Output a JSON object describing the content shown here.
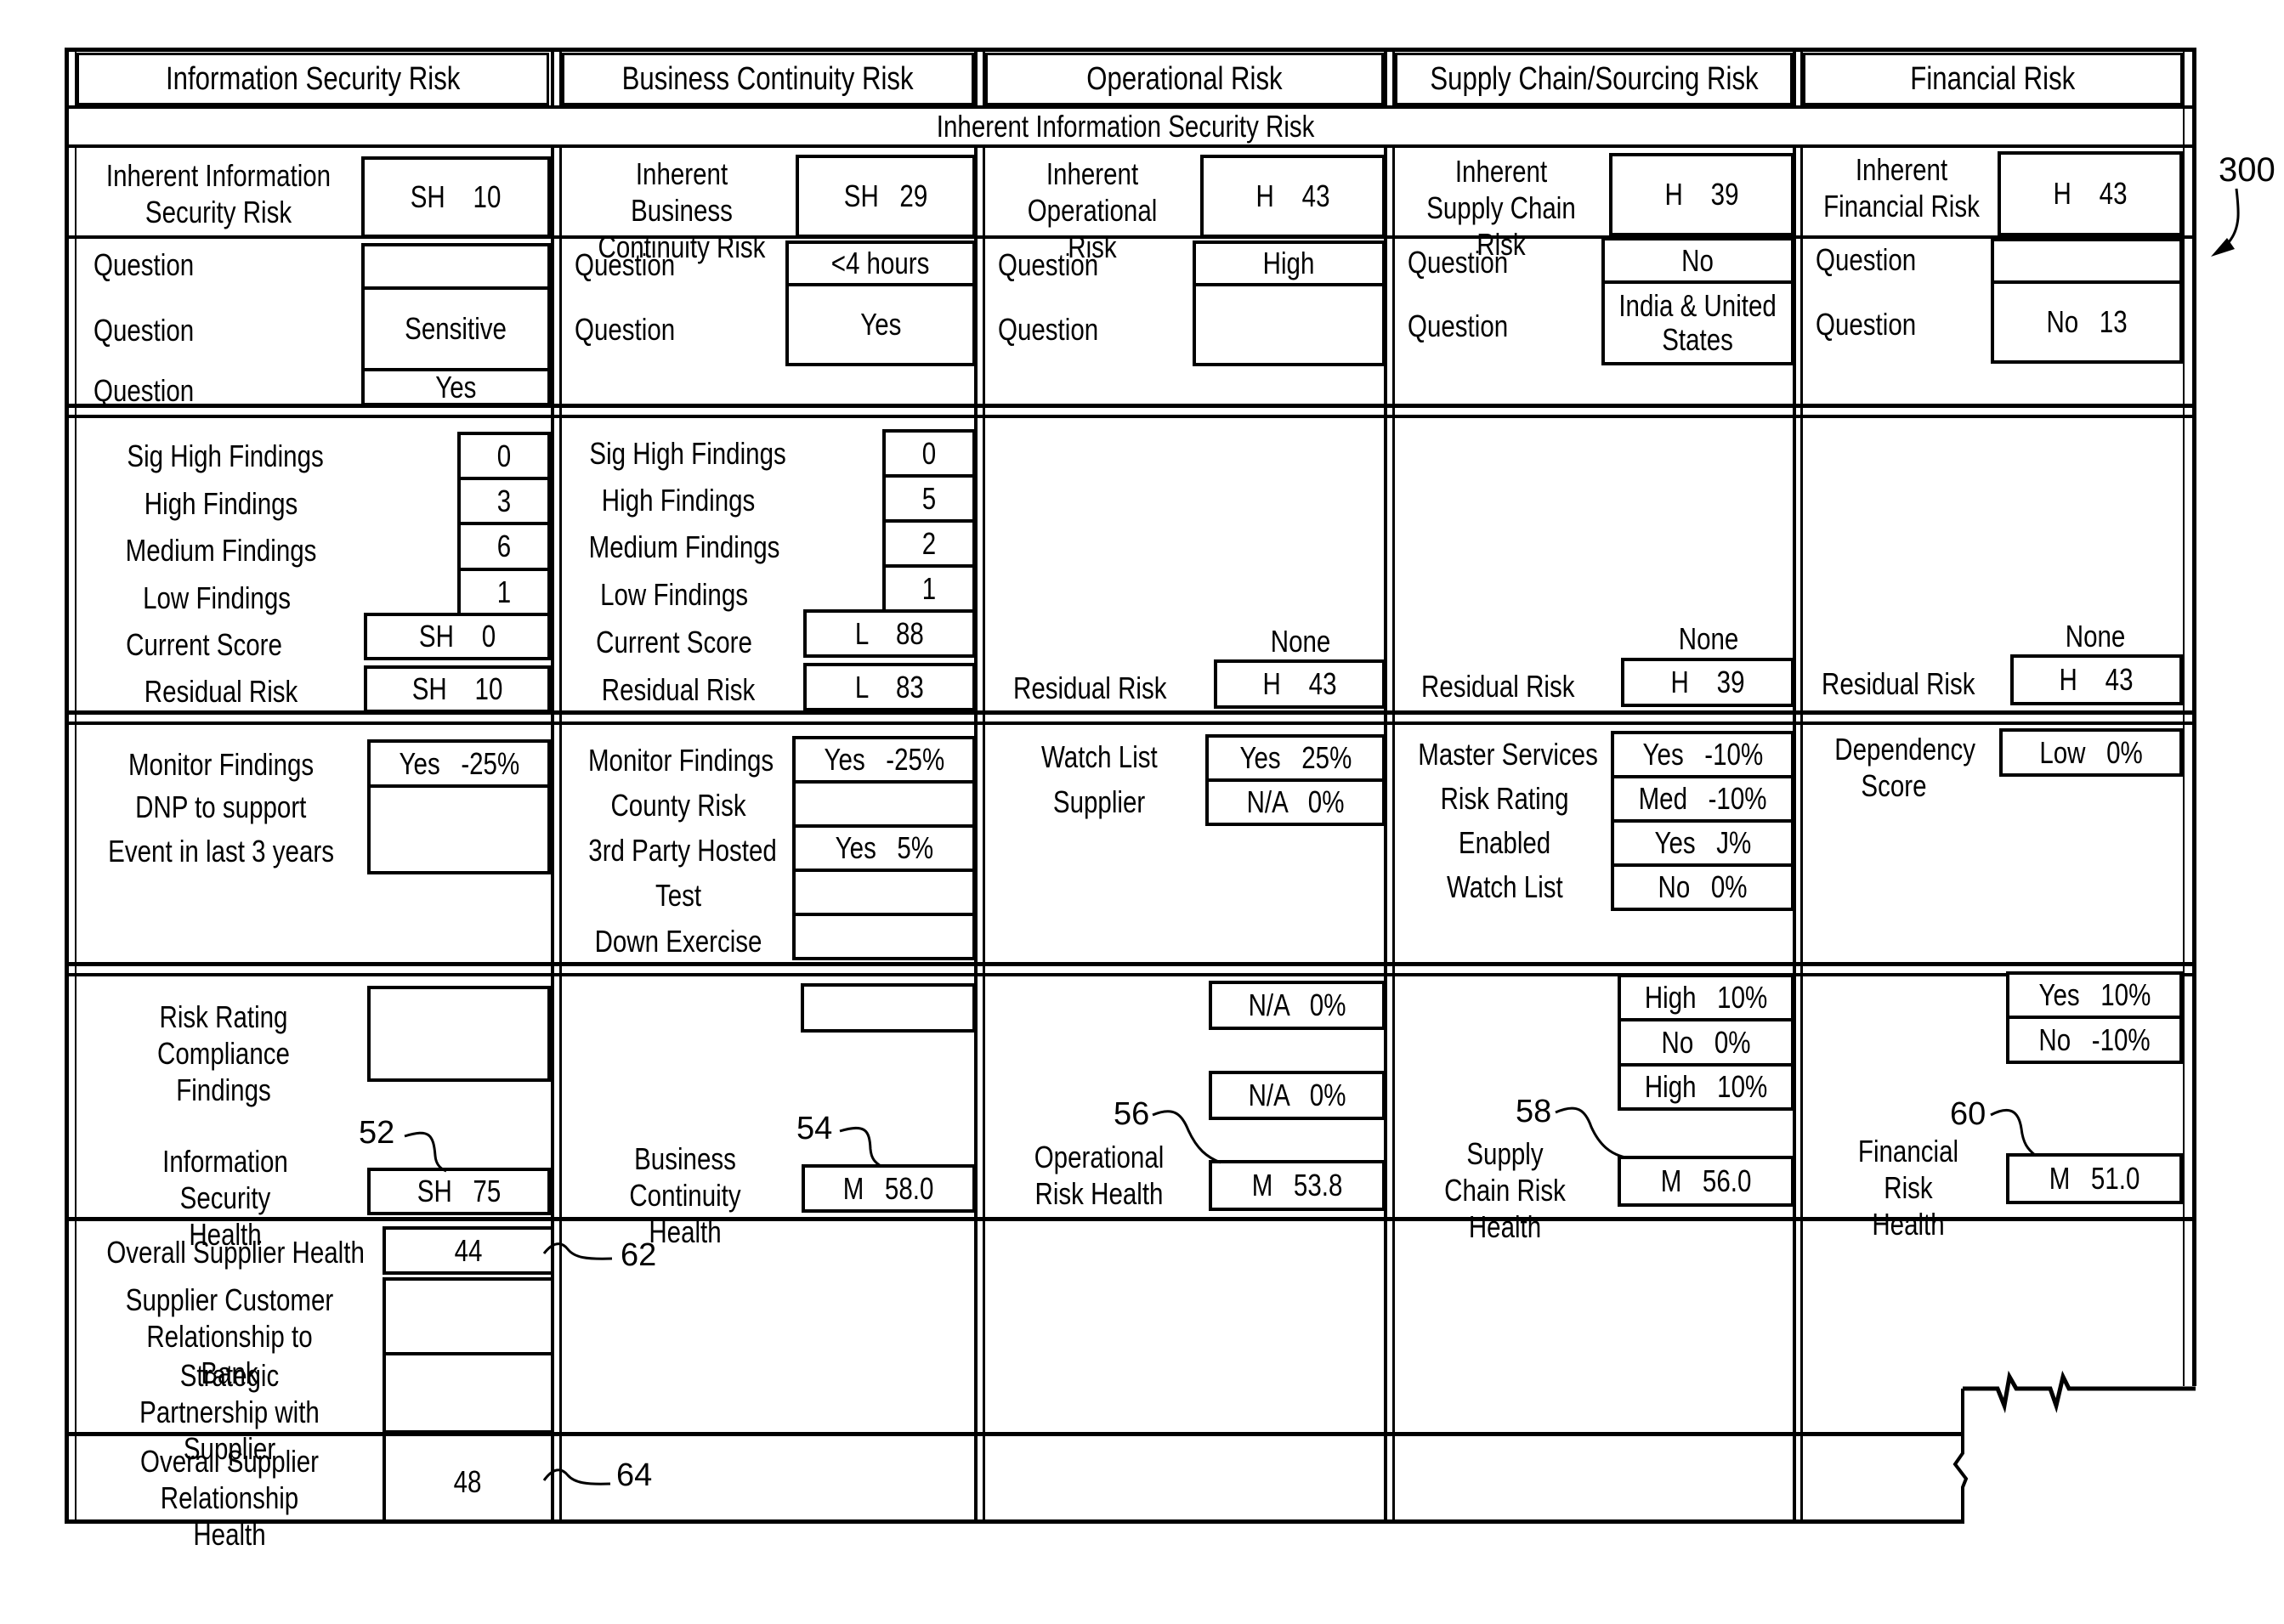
{
  "figure_label": "300",
  "columns": [
    {
      "header": "Information Security Risk"
    },
    {
      "header": "Business Continuity Risk"
    },
    {
      "header": "Operational Risk"
    },
    {
      "header": "Supply Chain/Sourcing Risk"
    },
    {
      "header": "Financial Risk"
    }
  ],
  "subheader": "Inherent Information Security Risk",
  "inherent": [
    {
      "label": "Inherent Information Security Risk",
      "value": "SH    10"
    },
    {
      "label": "Inherent Business Continuity Risk",
      "value": "SH   29"
    },
    {
      "label": "Inherent Operational Risk",
      "value": "H    43"
    },
    {
      "label": "Inherent Supply Chain Risk",
      "value": "H    39"
    },
    {
      "label": "Inherent Financial Risk",
      "value": "H    43"
    }
  ],
  "questions": {
    "info_security": [
      {
        "label": "Question",
        "value": ""
      },
      {
        "label": "Question",
        "value": "Sensitive"
      },
      {
        "label": "Question",
        "value": "Yes"
      }
    ],
    "business_continuity": [
      {
        "label": "Question",
        "value": "<4 hours"
      },
      {
        "label": "Question",
        "value": "Yes"
      }
    ],
    "operational": [
      {
        "label": "Question",
        "value": "High"
      },
      {
        "label": "Question",
        "value": ""
      }
    ],
    "supply_chain": [
      {
        "label": "Question",
        "value": "No"
      },
      {
        "label": "Question",
        "value": "India & United\nStates"
      }
    ],
    "financial": [
      {
        "label": "Question",
        "value": ""
      },
      {
        "label": "Question",
        "value": "No   13"
      }
    ]
  },
  "findings": {
    "info_security": {
      "sig_high": {
        "label": "Sig High Findings",
        "value": "0"
      },
      "high": {
        "label": "High Findings",
        "value": "3"
      },
      "medium": {
        "label": "Medium Findings",
        "value": "6"
      },
      "low": {
        "label": "Low Findings",
        "value": "1"
      },
      "current_score": {
        "label": "Current Score",
        "value": "SH    0"
      },
      "residual_risk": {
        "label": "Residual Risk",
        "value": "SH    10"
      }
    },
    "business_continuity": {
      "sig_high": {
        "label": "Sig High Findings",
        "value": "0"
      },
      "high": {
        "label": "High Findings",
        "value": "5"
      },
      "medium": {
        "label": "Medium Findings",
        "value": "2"
      },
      "low": {
        "label": "Low Findings",
        "value": "1"
      },
      "current_score": {
        "label": "Current Score",
        "value": "L    88"
      },
      "residual_risk": {
        "label": "Residual Risk",
        "value": "L    83"
      }
    },
    "operational": {
      "none_label": "None",
      "residual_label": "Residual Risk",
      "residual_value": "H    43"
    },
    "supply_chain": {
      "none_label": "None",
      "residual_label": "Residual Risk",
      "residual_value": "H    39"
    },
    "financial": {
      "none_label": "None",
      "residual_label": "Residual Risk",
      "residual_value": "H    43"
    }
  },
  "adjustments": {
    "info_security": [
      {
        "label": "Monitor Findings",
        "value": "Yes   -25%"
      },
      {
        "label": "DNP to support",
        "value": ""
      },
      {
        "label": "Event in last 3 years",
        "value": ""
      }
    ],
    "business_continuity": [
      {
        "label": "Monitor Findings",
        "value": "Yes   -25%"
      },
      {
        "label": "County Risk",
        "value": ""
      },
      {
        "label": "3rd Party Hosted",
        "value": "Yes   5%"
      },
      {
        "label": "Test",
        "value": ""
      },
      {
        "label": "Down Exercise",
        "value": ""
      }
    ],
    "operational": [
      {
        "label": "Watch List",
        "value": "Yes   25%"
      },
      {
        "label": "Supplier",
        "value": "N/A   0%"
      }
    ],
    "supply_chain": [
      {
        "label": "Master Services",
        "value": "Yes   -10%"
      },
      {
        "label": "Risk Rating",
        "value": "Med   -10%"
      },
      {
        "label": "Enabled",
        "value": "Yes   J%"
      },
      {
        "label": "Watch List",
        "value": "No   0%"
      }
    ],
    "financial": [
      {
        "label": "Dependency Score",
        "value": "Low   0%"
      }
    ]
  },
  "health": {
    "info_security": {
      "extra_label": "Risk Rating Compliance Findings",
      "extra_value": "",
      "label": "Information Security Health",
      "value": "SH   75",
      "ref": "52"
    },
    "business_continuity": {
      "extra_value": "",
      "label": "Business Continuity Health",
      "value": "M   58.0",
      "ref": "54"
    },
    "operational": {
      "boxes": [
        "N/A   0%",
        "N/A   0%"
      ],
      "label": "Operational Risk Health",
      "value": "M   53.8",
      "ref": "56"
    },
    "supply_chain": {
      "boxes": [
        "High   10%",
        "No   0%",
        "High   10%"
      ],
      "label": "Supply Chain Risk Health",
      "value": "M   56.0",
      "ref": "58"
    },
    "financial": {
      "boxes": [
        "Yes   10%",
        "No   -10%"
      ],
      "label": "Financial Risk Health",
      "value": "M   51.0",
      "ref": "60"
    }
  },
  "overall": {
    "supplier_health": {
      "label": "Overall Supplier Health",
      "value": "44",
      "ref": "62"
    },
    "customer_relationship": {
      "label": "Supplier Customer Relationship to Bank",
      "value": ""
    },
    "strategic_partnership": {
      "label": "Strategic Partnership with Supplier",
      "value": ""
    },
    "relationship_health": {
      "label": "Overall Supplier Relationship Health",
      "value": "48",
      "ref": "64"
    }
  }
}
